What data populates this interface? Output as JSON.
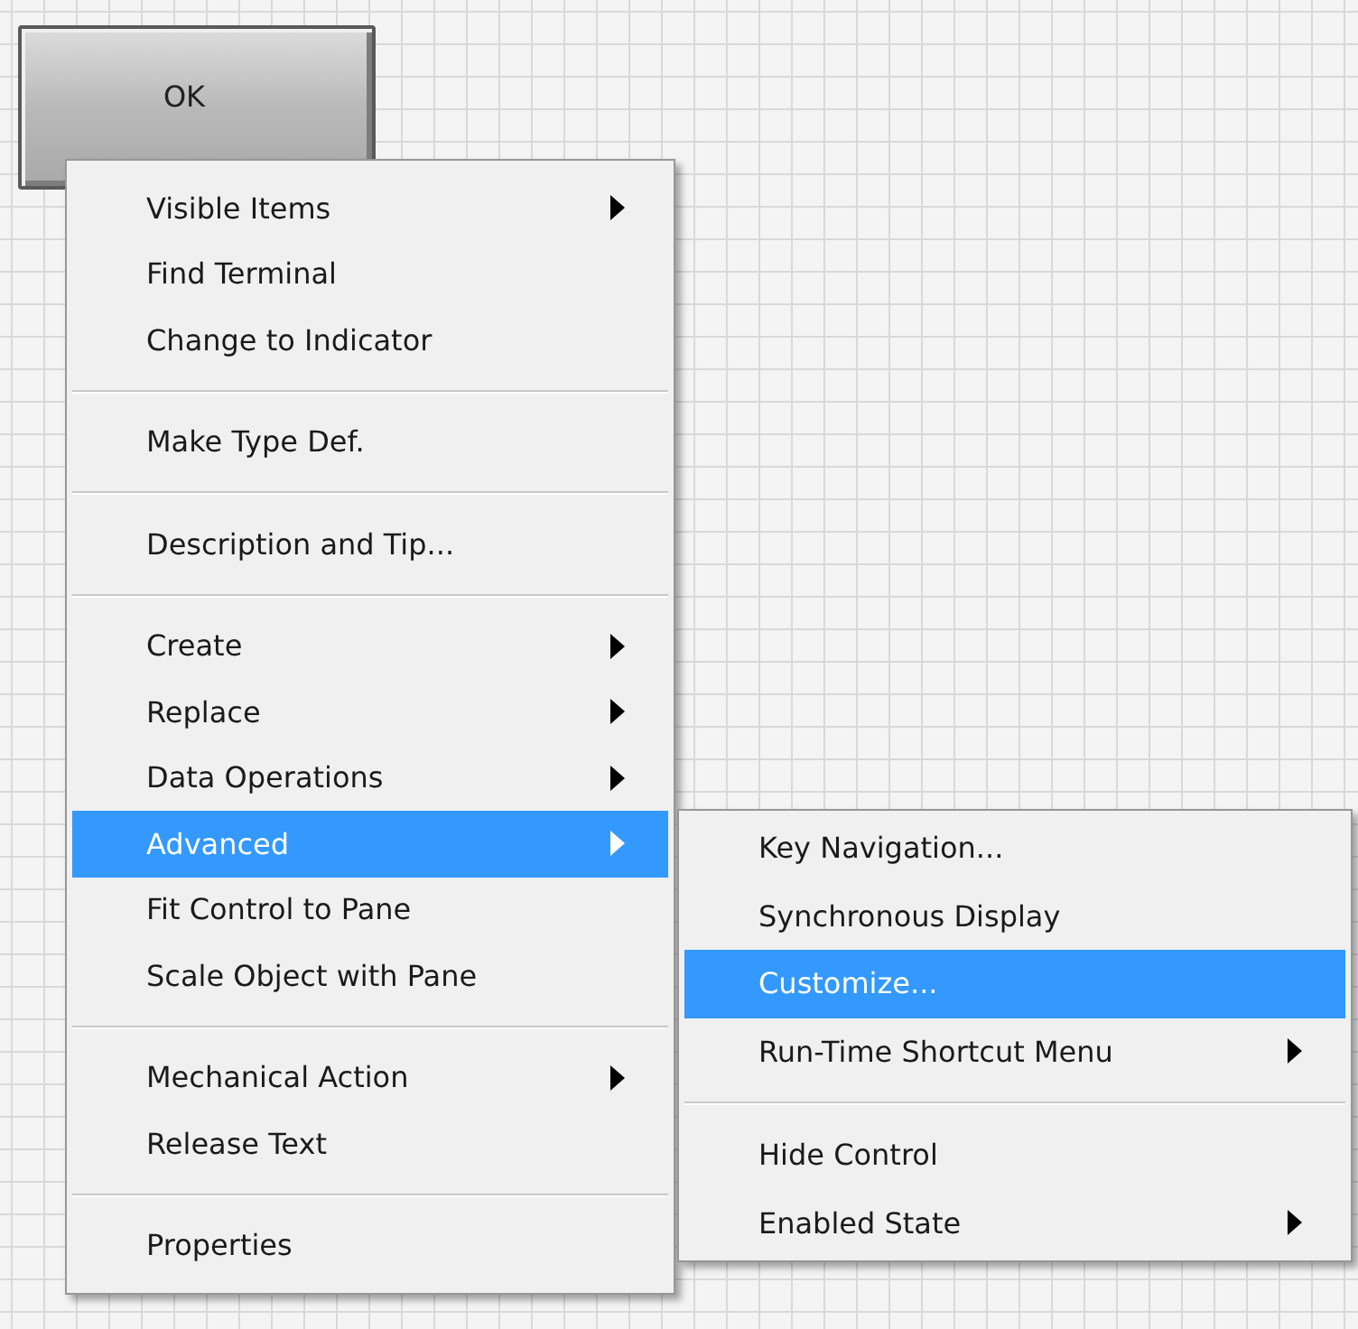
{
  "button": {
    "label": "OK"
  },
  "menu": {
    "items": [
      {
        "kind": "item",
        "label": "Visible Items",
        "submenu": true,
        "selected": false
      },
      {
        "kind": "item",
        "label": "Find Terminal",
        "submenu": false,
        "selected": false
      },
      {
        "kind": "item",
        "label": "Change to Indicator",
        "submenu": false,
        "selected": false
      },
      {
        "kind": "separator"
      },
      {
        "kind": "item",
        "label": "Make Type Def.",
        "submenu": false,
        "selected": false
      },
      {
        "kind": "separator"
      },
      {
        "kind": "item",
        "label": "Description and Tip...",
        "submenu": false,
        "selected": false
      },
      {
        "kind": "separator"
      },
      {
        "kind": "item",
        "label": "Create",
        "submenu": true,
        "selected": false
      },
      {
        "kind": "item",
        "label": "Replace",
        "submenu": true,
        "selected": false
      },
      {
        "kind": "item",
        "label": "Data Operations",
        "submenu": true,
        "selected": false
      },
      {
        "kind": "item",
        "label": "Advanced",
        "submenu": true,
        "selected": true
      },
      {
        "kind": "item",
        "label": "Fit Control to Pane",
        "submenu": false,
        "selected": false
      },
      {
        "kind": "item",
        "label": "Scale Object with Pane",
        "submenu": false,
        "selected": false
      },
      {
        "kind": "separator"
      },
      {
        "kind": "item",
        "label": "Mechanical Action",
        "submenu": true,
        "selected": false
      },
      {
        "kind": "item",
        "label": "Release Text",
        "submenu": false,
        "selected": false
      },
      {
        "kind": "separator"
      },
      {
        "kind": "item",
        "label": "Properties",
        "submenu": false,
        "selected": false
      }
    ]
  },
  "submenu": {
    "items": [
      {
        "kind": "item",
        "label": "Key Navigation...",
        "submenu": false,
        "selected": false
      },
      {
        "kind": "item",
        "label": "Synchronous Display",
        "submenu": false,
        "selected": false
      },
      {
        "kind": "item",
        "label": "Customize...",
        "submenu": false,
        "selected": true
      },
      {
        "kind": "item",
        "label": "Run-Time Shortcut Menu",
        "submenu": true,
        "selected": false
      },
      {
        "kind": "separator"
      },
      {
        "kind": "item",
        "label": "Hide Control",
        "submenu": false,
        "selected": false
      },
      {
        "kind": "item",
        "label": "Enabled State",
        "submenu": true,
        "selected": false
      }
    ]
  }
}
